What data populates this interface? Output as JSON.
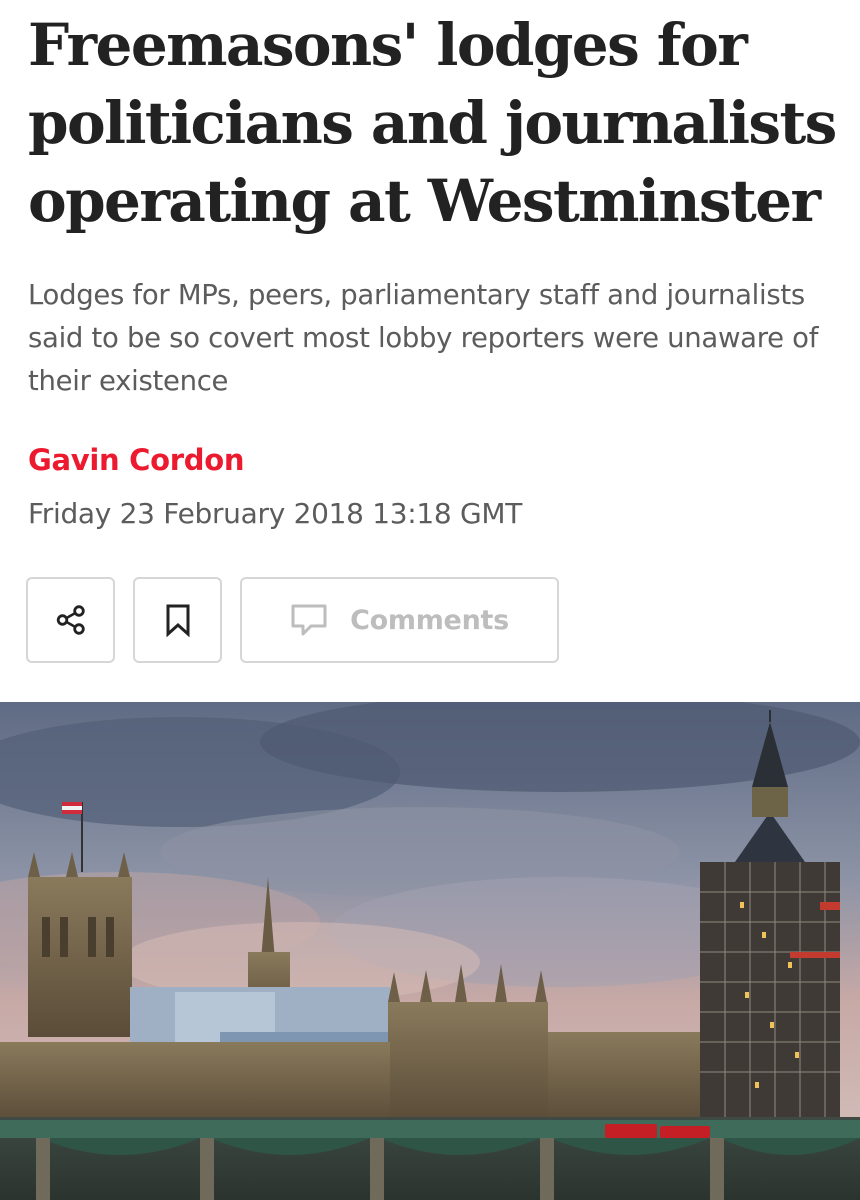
{
  "article": {
    "headline": "Freemasons' lodges for politicians and journalists operating at Westminster",
    "standfirst": "Lodges for MPs, peers, parliamentary staff and journalists said to be so covert most lobby reporters were unaware of their existence",
    "author": "Gavin Cordon",
    "published": "Friday 23 February 2018 13:18 GMT"
  },
  "actions": {
    "share_icon": "share-icon",
    "bookmark_icon": "bookmark-icon",
    "comments_icon": "speech-bubble-icon",
    "comments_label": "Comments"
  },
  "colors": {
    "accent": "#ec1a2e",
    "headline": "#222222",
    "body_text": "#5c5c5c",
    "button_border": "#d6d6d6",
    "disabled_text": "#bdbdbd"
  }
}
